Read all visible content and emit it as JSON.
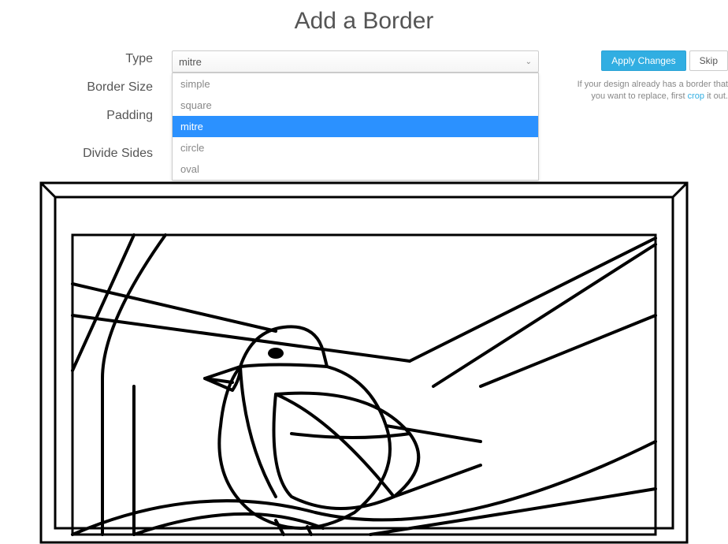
{
  "title": "Add a Border",
  "labels": {
    "type": "Type",
    "border_size": "Border Size",
    "padding": "Padding",
    "divide_sides": "Divide Sides"
  },
  "select": {
    "value": "mitre",
    "options": [
      "simple",
      "square",
      "mitre",
      "circle",
      "oval"
    ]
  },
  "buttons": {
    "apply": "Apply Changes",
    "skip": "Skip"
  },
  "help": {
    "prefix": "If your design already has a border that you want to replace, first ",
    "link": "crop",
    "suffix": " it out."
  }
}
